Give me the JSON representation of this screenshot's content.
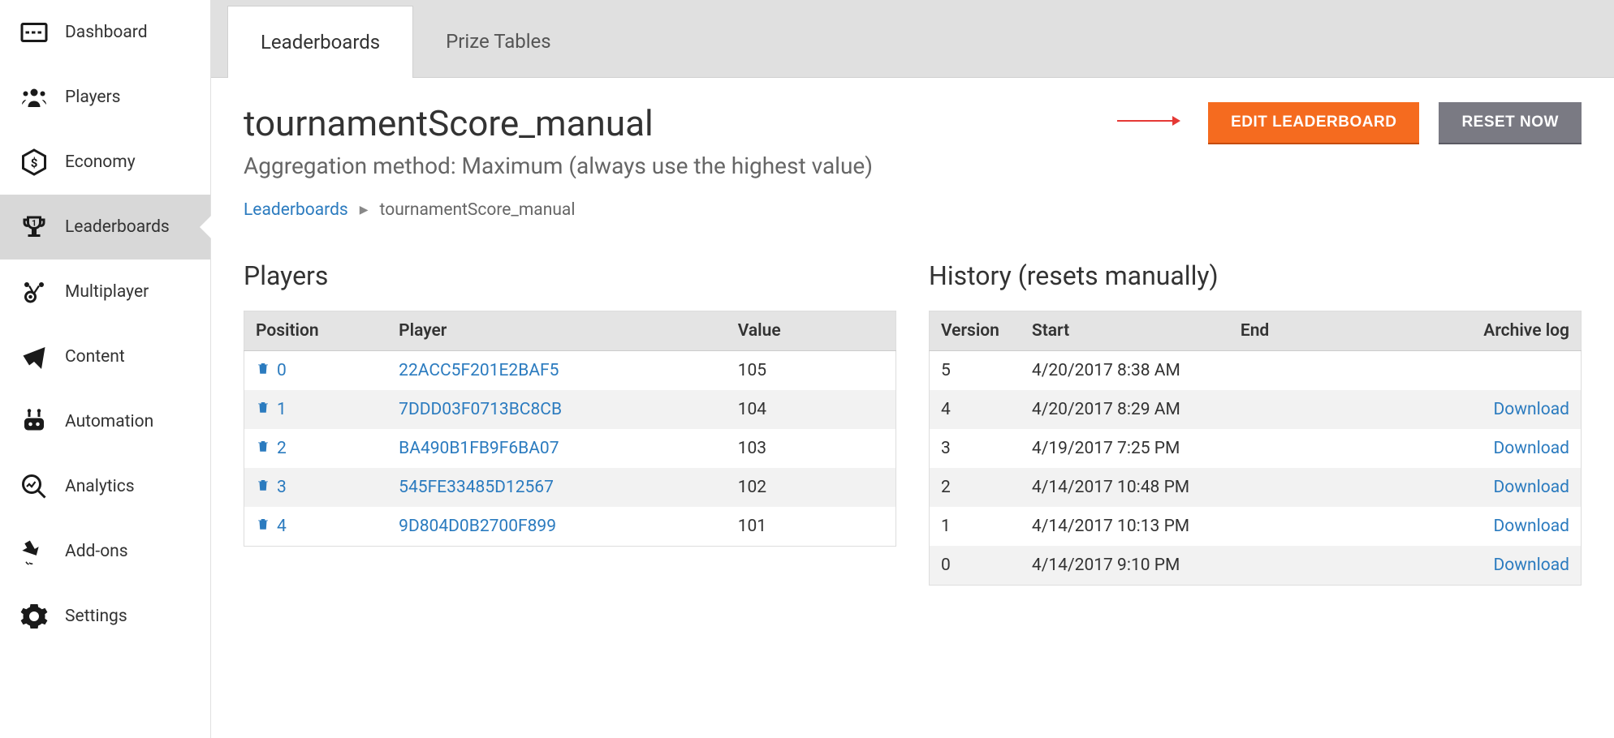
{
  "sidebar": {
    "items": [
      {
        "label": "Dashboard"
      },
      {
        "label": "Players"
      },
      {
        "label": "Economy"
      },
      {
        "label": "Leaderboards"
      },
      {
        "label": "Multiplayer"
      },
      {
        "label": "Content"
      },
      {
        "label": "Automation"
      },
      {
        "label": "Analytics"
      },
      {
        "label": "Add-ons"
      },
      {
        "label": "Settings"
      }
    ]
  },
  "tabs": [
    {
      "label": "Leaderboards",
      "active": true
    },
    {
      "label": "Prize Tables",
      "active": false
    }
  ],
  "page": {
    "title": "tournamentScore_manual",
    "subtitle": "Aggregation method: Maximum (always use the highest value)",
    "edit_button": "EDIT LEADERBOARD",
    "reset_button": "RESET NOW"
  },
  "breadcrumb": {
    "root": "Leaderboards",
    "current": "tournamentScore_manual"
  },
  "players_panel": {
    "title": "Players",
    "columns": {
      "position": "Position",
      "player": "Player",
      "value": "Value"
    },
    "rows": [
      {
        "position": "0",
        "player": "22ACC5F201E2BAF5",
        "value": "105"
      },
      {
        "position": "1",
        "player": "7DDD03F0713BC8CB",
        "value": "104"
      },
      {
        "position": "2",
        "player": "BA490B1FB9F6BA07",
        "value": "103"
      },
      {
        "position": "3",
        "player": "545FE33485D12567",
        "value": "102"
      },
      {
        "position": "4",
        "player": "9D804D0B2700F899",
        "value": "101"
      }
    ]
  },
  "history_panel": {
    "title": "History (resets manually)",
    "columns": {
      "version": "Version",
      "start": "Start",
      "end": "End",
      "archive": "Archive log"
    },
    "download_label": "Download",
    "rows": [
      {
        "version": "5",
        "start": "4/20/2017 8:38 AM",
        "end": "",
        "download": false
      },
      {
        "version": "4",
        "start": "4/20/2017 8:29 AM",
        "end": "",
        "download": true
      },
      {
        "version": "3",
        "start": "4/19/2017 7:25 PM",
        "end": "",
        "download": true
      },
      {
        "version": "2",
        "start": "4/14/2017 10:48 PM",
        "end": "",
        "download": true
      },
      {
        "version": "1",
        "start": "4/14/2017 10:13 PM",
        "end": "",
        "download": true
      },
      {
        "version": "0",
        "start": "4/14/2017 9:10 PM",
        "end": "",
        "download": true
      }
    ]
  }
}
